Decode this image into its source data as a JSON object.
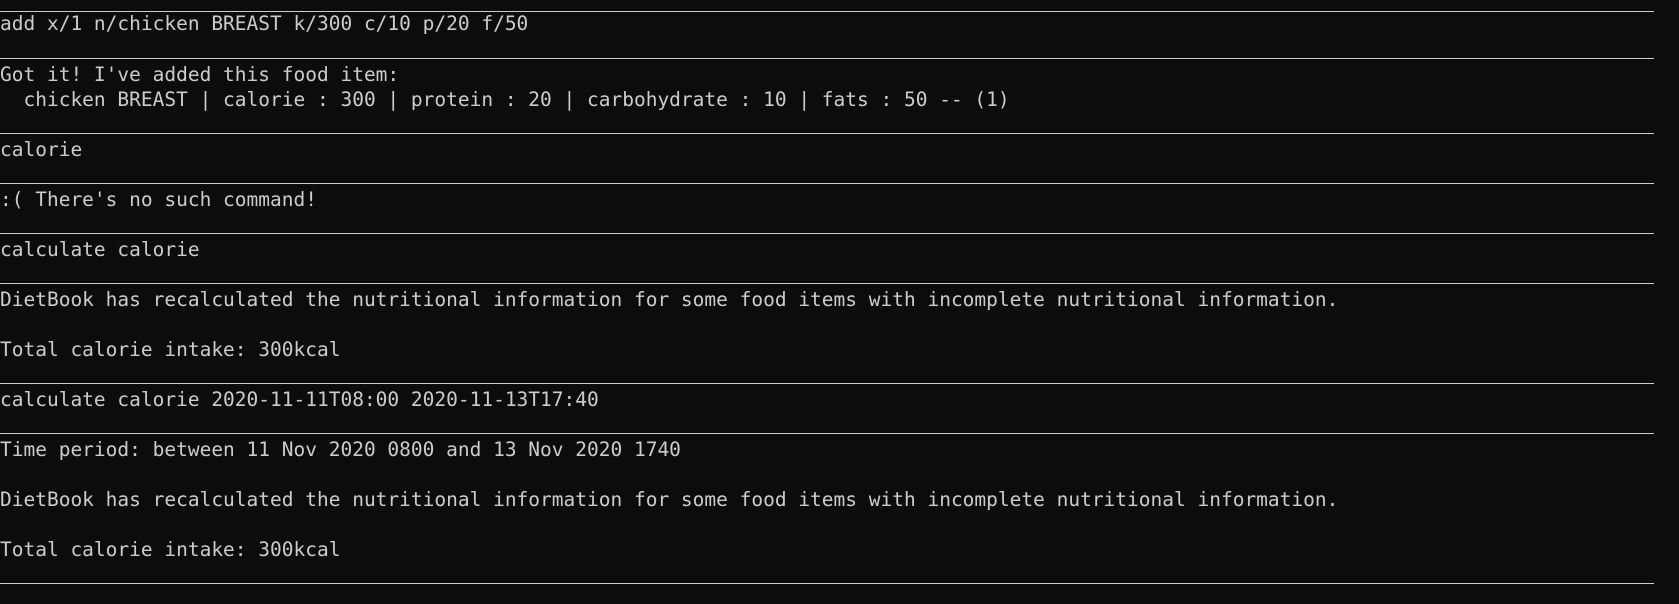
{
  "terminal": {
    "lines": [
      "add x/1 n/chicken BREAST k/300 c/10 p/20 f/50",
      "Got it! I've added this food item:",
      "  chicken BREAST | calorie : 300 | protein : 20 | carbohydrate : 10 | fats : 50 -- (1)",
      "calorie",
      ":( There's no such command!",
      "calculate calorie",
      "DietBook has recalculated the nutritional information for some food items with incomplete nutritional information.",
      "Total calorie intake: 300kcal",
      "calculate calorie 2020-11-11T08:00 2020-11-13T17:40",
      "Time period: between 11 Nov 2020 0800 and 13 Nov 2020 1740",
      "DietBook has recalculated the nutritional information for some food items with incomplete nutritional information.",
      "Total calorie intake: 300kcal"
    ]
  },
  "colors": {
    "background": "#0c0c0c",
    "text": "#cccccc"
  }
}
